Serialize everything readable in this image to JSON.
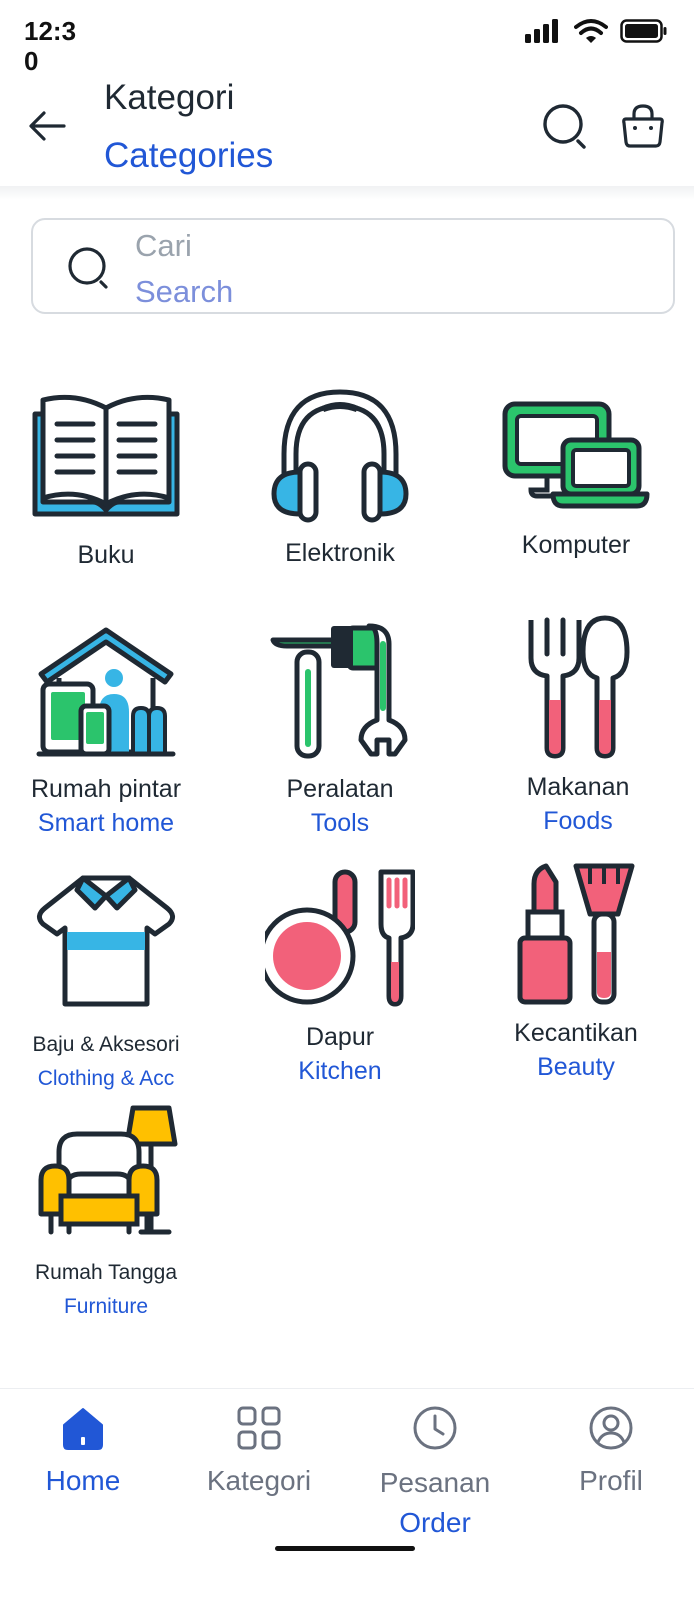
{
  "status_bar": {
    "time": "12:30"
  },
  "header": {
    "title": "Kategori",
    "subtitle": "Categories"
  },
  "search": {
    "placeholder": "Cari",
    "placeholder_en": "Search"
  },
  "categories": [
    {
      "label": "Buku",
      "label_en": "",
      "icon": "book-icon"
    },
    {
      "label": "Elektronik",
      "label_en": "",
      "icon": "headphones-icon"
    },
    {
      "label": "Komputer",
      "label_en": "",
      "icon": "computer-icon"
    },
    {
      "label": "Rumah pintar",
      "label_en": "Smart home",
      "icon": "smart-home-icon"
    },
    {
      "label": "Peralatan",
      "label_en": "Tools",
      "icon": "tools-icon"
    },
    {
      "label": "Makanan",
      "label_en": "Foods",
      "icon": "utensils-icon"
    },
    {
      "label": "Baju & Aksesori",
      "label_en": "Clothing & Acc",
      "icon": "shirt-icon"
    },
    {
      "label": "Dapur",
      "label_en": "Kitchen",
      "icon": "pan-icon"
    },
    {
      "label": "Kecantikan",
      "label_en": "Beauty",
      "icon": "makeup-icon"
    },
    {
      "label": "Rumah Tangga",
      "label_en": "Furniture",
      "icon": "sofa-icon"
    }
  ],
  "bottom_nav": [
    {
      "label": "Home",
      "label_en": "",
      "icon": "home-icon",
      "active": true
    },
    {
      "label": "Kategori",
      "label_en": "",
      "icon": "grid-icon",
      "active": false
    },
    {
      "label": "Pesanan",
      "label_en": "Order",
      "icon": "clock-icon",
      "active": false
    },
    {
      "label": "Profil",
      "label_en": "",
      "icon": "user-icon",
      "active": false
    }
  ],
  "colors": {
    "accent": "#2157d6",
    "icon_blue": "#37b5e5",
    "icon_green": "#2bc46c",
    "icon_pink": "#f2617a",
    "icon_yellow": "#ffc000"
  }
}
